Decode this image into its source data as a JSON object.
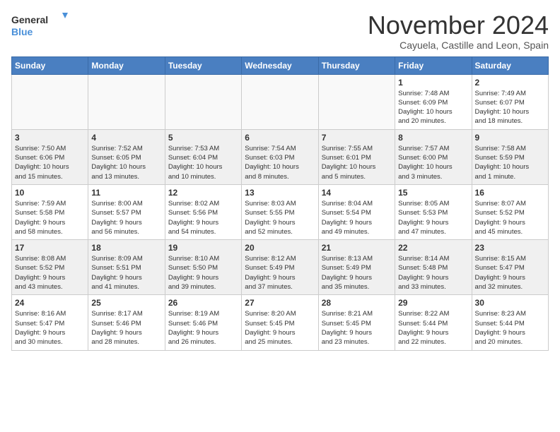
{
  "header": {
    "logo_line1": "General",
    "logo_line2": "Blue",
    "month": "November 2024",
    "location": "Cayuela, Castille and Leon, Spain"
  },
  "weekdays": [
    "Sunday",
    "Monday",
    "Tuesday",
    "Wednesday",
    "Thursday",
    "Friday",
    "Saturday"
  ],
  "weeks": [
    [
      {
        "day": "",
        "info": ""
      },
      {
        "day": "",
        "info": ""
      },
      {
        "day": "",
        "info": ""
      },
      {
        "day": "",
        "info": ""
      },
      {
        "day": "",
        "info": ""
      },
      {
        "day": "1",
        "info": "Sunrise: 7:48 AM\nSunset: 6:09 PM\nDaylight: 10 hours\nand 20 minutes."
      },
      {
        "day": "2",
        "info": "Sunrise: 7:49 AM\nSunset: 6:07 PM\nDaylight: 10 hours\nand 18 minutes."
      }
    ],
    [
      {
        "day": "3",
        "info": "Sunrise: 7:50 AM\nSunset: 6:06 PM\nDaylight: 10 hours\nand 15 minutes."
      },
      {
        "day": "4",
        "info": "Sunrise: 7:52 AM\nSunset: 6:05 PM\nDaylight: 10 hours\nand 13 minutes."
      },
      {
        "day": "5",
        "info": "Sunrise: 7:53 AM\nSunset: 6:04 PM\nDaylight: 10 hours\nand 10 minutes."
      },
      {
        "day": "6",
        "info": "Sunrise: 7:54 AM\nSunset: 6:03 PM\nDaylight: 10 hours\nand 8 minutes."
      },
      {
        "day": "7",
        "info": "Sunrise: 7:55 AM\nSunset: 6:01 PM\nDaylight: 10 hours\nand 5 minutes."
      },
      {
        "day": "8",
        "info": "Sunrise: 7:57 AM\nSunset: 6:00 PM\nDaylight: 10 hours\nand 3 minutes."
      },
      {
        "day": "9",
        "info": "Sunrise: 7:58 AM\nSunset: 5:59 PM\nDaylight: 10 hours\nand 1 minute."
      }
    ],
    [
      {
        "day": "10",
        "info": "Sunrise: 7:59 AM\nSunset: 5:58 PM\nDaylight: 9 hours\nand 58 minutes."
      },
      {
        "day": "11",
        "info": "Sunrise: 8:00 AM\nSunset: 5:57 PM\nDaylight: 9 hours\nand 56 minutes."
      },
      {
        "day": "12",
        "info": "Sunrise: 8:02 AM\nSunset: 5:56 PM\nDaylight: 9 hours\nand 54 minutes."
      },
      {
        "day": "13",
        "info": "Sunrise: 8:03 AM\nSunset: 5:55 PM\nDaylight: 9 hours\nand 52 minutes."
      },
      {
        "day": "14",
        "info": "Sunrise: 8:04 AM\nSunset: 5:54 PM\nDaylight: 9 hours\nand 49 minutes."
      },
      {
        "day": "15",
        "info": "Sunrise: 8:05 AM\nSunset: 5:53 PM\nDaylight: 9 hours\nand 47 minutes."
      },
      {
        "day": "16",
        "info": "Sunrise: 8:07 AM\nSunset: 5:52 PM\nDaylight: 9 hours\nand 45 minutes."
      }
    ],
    [
      {
        "day": "17",
        "info": "Sunrise: 8:08 AM\nSunset: 5:52 PM\nDaylight: 9 hours\nand 43 minutes."
      },
      {
        "day": "18",
        "info": "Sunrise: 8:09 AM\nSunset: 5:51 PM\nDaylight: 9 hours\nand 41 minutes."
      },
      {
        "day": "19",
        "info": "Sunrise: 8:10 AM\nSunset: 5:50 PM\nDaylight: 9 hours\nand 39 minutes."
      },
      {
        "day": "20",
        "info": "Sunrise: 8:12 AM\nSunset: 5:49 PM\nDaylight: 9 hours\nand 37 minutes."
      },
      {
        "day": "21",
        "info": "Sunrise: 8:13 AM\nSunset: 5:49 PM\nDaylight: 9 hours\nand 35 minutes."
      },
      {
        "day": "22",
        "info": "Sunrise: 8:14 AM\nSunset: 5:48 PM\nDaylight: 9 hours\nand 33 minutes."
      },
      {
        "day": "23",
        "info": "Sunrise: 8:15 AM\nSunset: 5:47 PM\nDaylight: 9 hours\nand 32 minutes."
      }
    ],
    [
      {
        "day": "24",
        "info": "Sunrise: 8:16 AM\nSunset: 5:47 PM\nDaylight: 9 hours\nand 30 minutes."
      },
      {
        "day": "25",
        "info": "Sunrise: 8:17 AM\nSunset: 5:46 PM\nDaylight: 9 hours\nand 28 minutes."
      },
      {
        "day": "26",
        "info": "Sunrise: 8:19 AM\nSunset: 5:46 PM\nDaylight: 9 hours\nand 26 minutes."
      },
      {
        "day": "27",
        "info": "Sunrise: 8:20 AM\nSunset: 5:45 PM\nDaylight: 9 hours\nand 25 minutes."
      },
      {
        "day": "28",
        "info": "Sunrise: 8:21 AM\nSunset: 5:45 PM\nDaylight: 9 hours\nand 23 minutes."
      },
      {
        "day": "29",
        "info": "Sunrise: 8:22 AM\nSunset: 5:44 PM\nDaylight: 9 hours\nand 22 minutes."
      },
      {
        "day": "30",
        "info": "Sunrise: 8:23 AM\nSunset: 5:44 PM\nDaylight: 9 hours\nand 20 minutes."
      }
    ]
  ]
}
